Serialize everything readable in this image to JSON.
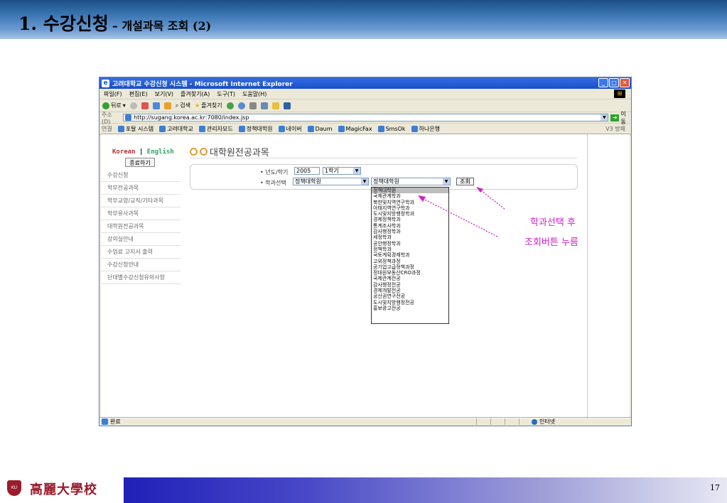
{
  "slide": {
    "title": "1. 수강신청",
    "subtitle": "– 개설과목 조회 (2)",
    "page_number": "17",
    "footer_logo_text": "高麗大學校"
  },
  "browser": {
    "title": "고려대학교 수강신청 시스템 - Microsoft Internet Explorer",
    "menu": [
      "파일(F)",
      "편집(E)",
      "보기(V)",
      "즐겨찾기(A)",
      "도구(T)",
      "도움말(H)"
    ],
    "toolbar": {
      "back": "뒤로",
      "search": "검색",
      "favorites": "즐겨찾기"
    },
    "address_label": "주소(D)",
    "address": "http://sugang.korea.ac.kr:7080/index.jsp",
    "go_label": "이동",
    "links_label": "연결",
    "links": [
      "포탈 시스템",
      "고려대학교",
      "관리자모드",
      "정책대학원",
      "네이버",
      "Daum",
      "MagicFax",
      "SmsOk",
      "하나은행"
    ],
    "links_right": "V3 방패",
    "status": "완료",
    "zone": "인터넷"
  },
  "page": {
    "lang_korean": "Korean",
    "lang_sep": "|",
    "lang_english": "English",
    "logout_label": "종료하기",
    "nav": [
      "수강신청",
      "학부전공과목",
      "학부교양/교직/기타과목",
      "학부유사과목",
      "대학원전공과목",
      "강의실안내",
      "수업료 고지서 출력",
      "수강신청안내",
      "단대별수강신청유의사항"
    ],
    "title": "대학원전공과목",
    "year_label": "• 년도/학기",
    "year_value": "2005",
    "semester_value": "1학기",
    "dept_label": "• 학과선택",
    "college_value": "정책대학원",
    "dept_value": "정책대학원",
    "search_button": "조회",
    "dept_options": [
      "정책대학원",
      "국제관계학과",
      "북한및지역연구학과",
      "아태지역연구학과",
      "도시및지방행정학과",
      "경제정책학과",
      "통계조사학과",
      "감사행정학과",
      "세정학과",
      "공안행정학과",
      "정책학과",
      "국토계획경제학과",
      "고위정책과정",
      "공기업고급정책과정",
      "정대원부동산CRO과정",
      "국제관계전공",
      "감사행정전공",
      "경제개발전공",
      "공산권연구전공",
      "도시및지방행정전공",
      "홍보광고전공"
    ],
    "selected_option": "정책대학원"
  },
  "annotation": {
    "line1": "학과선택 후",
    "line2": "조회버튼 누름",
    "color": "#d020d0"
  }
}
